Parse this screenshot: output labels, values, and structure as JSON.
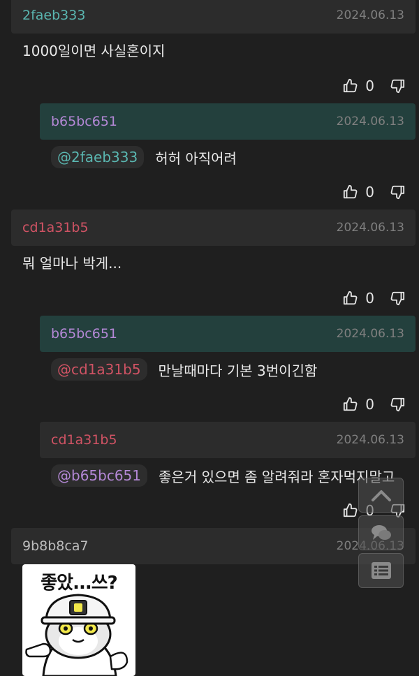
{
  "comments": [
    {
      "author": "2faeb333",
      "date": "2024.06.13",
      "text": "1000일이면 사실혼이지",
      "votes": "0"
    },
    {
      "author": "b65bc651",
      "date": "2024.06.13",
      "mention": "@2faeb333",
      "text": "허허 아직어려",
      "votes": "0"
    },
    {
      "author": "cd1a31b5",
      "date": "2024.06.13",
      "text": "뭐 얼마나 박게...",
      "votes": "0"
    },
    {
      "author": "b65bc651",
      "date": "2024.06.13",
      "mention": "@cd1a31b5",
      "text": "만날때마다 기본 3번이긴함",
      "votes": "0"
    },
    {
      "author": "cd1a31b5",
      "date": "2024.06.13",
      "mention": "@b65bc651",
      "text": "좋은거 있으면 좀 알려줘라 혼자먹지말고",
      "votes": "0"
    },
    {
      "author": "9b8b8ca7",
      "date": "2024.06.13"
    }
  ],
  "sticker": {
    "caption": "좋았...쓰?",
    "icon": "hardhat-cat-sticker"
  },
  "floating_buttons": [
    "scroll-top-icon",
    "comments-icon",
    "list-icon"
  ],
  "colors": {
    "teal": "#5ab6b0",
    "purple": "#b488d6",
    "red": "#d05364",
    "op_header": "#23403d"
  }
}
